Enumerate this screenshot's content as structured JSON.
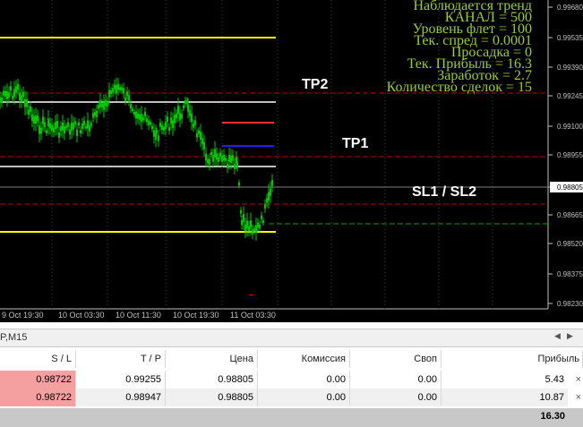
{
  "info_lines": [
    "Наблюдается тренд",
    "КАНАЛ = 500",
    "Уровень флет = 100",
    "Тек. спред =  0.0001",
    "Просадка  = 0",
    "Тек. Прибыль = 16.3",
    "Заработок  = 2.7",
    "Количество сделок = 15"
  ],
  "chart_labels": {
    "tp2": "TP2",
    "tp1": "TP1",
    "sl": "SL1 / SL2"
  },
  "price_axis": [
    "0.99680",
    "0.99535",
    "0.99390",
    "0.99245",
    "0.99100",
    "0.98955",
    "0.98805",
    "0.98665",
    "0.98520",
    "0.98375",
    "0.98230"
  ],
  "time_axis": [
    "9 Oct 19:30",
    "10 Oct 03:30",
    "10 Oct 11:30",
    "10 Oct 19:30",
    "11 Oct 03:30"
  ],
  "current_price_label": "0.98805",
  "tab": {
    "label": "P,M15"
  },
  "columns": [
    "S / L",
    "T / P",
    "Цена",
    "Комиссия",
    "Своп",
    "Прибыль"
  ],
  "rows": [
    {
      "sl": "0.98722",
      "tp": "0.99255",
      "price": "0.98805",
      "commission": "0.00",
      "swap": "0.00",
      "profit": "5.43"
    },
    {
      "sl": "0.98722",
      "tp": "0.98947",
      "price": "0.98805",
      "commission": "0.00",
      "swap": "0.00",
      "profit": "10.87"
    }
  ],
  "total": "16.30",
  "close_glyph": "×",
  "colors": {
    "info_text": "#9acd32",
    "candle": "#00c800",
    "yellow_line": "#ffff00",
    "white_line": "#c0c0c0",
    "red_line": "#ff3030",
    "blue_line": "#2020ff"
  }
}
